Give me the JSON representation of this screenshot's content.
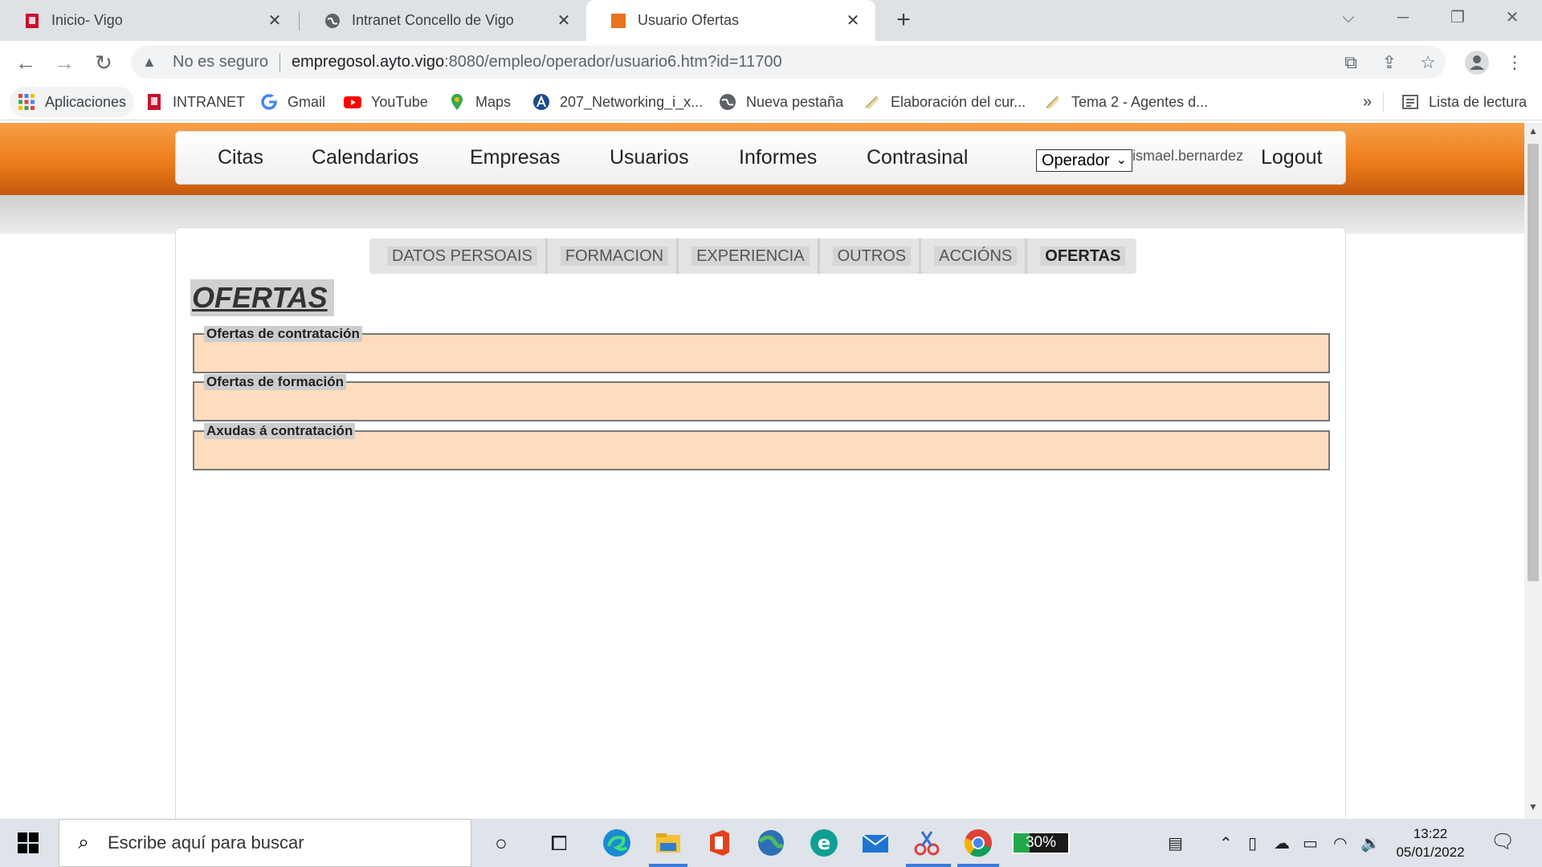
{
  "browser": {
    "tabs": [
      {
        "title": "Inicio- Vigo",
        "favicon": "vigo-crest-icon",
        "active": false
      },
      {
        "title": "Intranet Concello de Vigo",
        "favicon": "globe-icon",
        "active": false
      },
      {
        "title": "Usuario Ofertas",
        "favicon": "orange-square-icon",
        "active": true
      }
    ],
    "address": {
      "security_label": "No es seguro",
      "host": "empregosol.ayto.vigo",
      "path": ":8080/empleo/operador/usuario6.htm?id=11700"
    },
    "bookmarks": [
      {
        "label": "Aplicaciones",
        "icon": "apps-grid-icon"
      },
      {
        "label": "INTRANET",
        "icon": "vigo-crest-icon"
      },
      {
        "label": "Gmail",
        "icon": "google-g-icon"
      },
      {
        "label": "YouTube",
        "icon": "youtube-icon"
      },
      {
        "label": "Maps",
        "icon": "maps-pin-icon"
      },
      {
        "label": "207_Networking_i_x...",
        "icon": "drive-a-icon"
      },
      {
        "label": "Nueva pestaña",
        "icon": "globe-icon"
      },
      {
        "label": "Elaboración del cur...",
        "icon": "document-icon"
      },
      {
        "label": "Tema 2 - Agentes d...",
        "icon": "document-icon"
      }
    ],
    "bookmarks_more": "»",
    "reading_list": "Lista de lectura"
  },
  "app": {
    "nav": [
      "Citas",
      "Calendarios",
      "Empresas",
      "Usuarios",
      "Informes",
      "Contrasinal"
    ],
    "role_select": "Operador",
    "username": "ismael.bernardez",
    "logout": "Logout",
    "subtabs": [
      {
        "label": "DATOS PERSOAIS",
        "active": false
      },
      {
        "label": "FORMACION",
        "active": false
      },
      {
        "label": "EXPERIENCIA",
        "active": false
      },
      {
        "label": "OUTROS",
        "active": false
      },
      {
        "label": "ACCIÓNS",
        "active": false
      },
      {
        "label": "OFERTAS",
        "active": true
      }
    ],
    "section_title": "OFERTAS",
    "fieldsets": [
      "Ofertas de contratación",
      "Ofertas de formación",
      "Axudas á contratación"
    ],
    "colors": {
      "accent_orange": "#ec7c1a",
      "fieldset_bg": "#ffdcbd"
    }
  },
  "taskbar": {
    "search_placeholder": "Escribe aquí para buscar",
    "battery": "30%",
    "battery_level": 0.3,
    "time": "13:22",
    "date": "05/01/2022"
  }
}
